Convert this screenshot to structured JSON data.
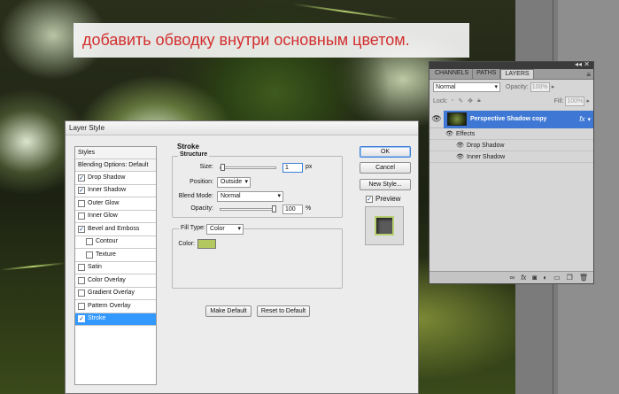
{
  "caption": "добавить обводку внутри основным цветом.",
  "layers_panel": {
    "tabs": [
      "CHANNELS",
      "PATHS",
      "LAYERS"
    ],
    "active_tab": "LAYERS",
    "blend_mode": "Normal",
    "opacity_label": "Opacity:",
    "opacity_value": "100%",
    "lock_label": "Lock:",
    "fill_label": "Fill:",
    "fill_value": "100%",
    "layer_name": "Perspective Shadow copy",
    "fx_label": "fx",
    "effects_label": "Effects",
    "effects": [
      "Drop Shadow",
      "Inner Shadow"
    ],
    "footer_icons": [
      "link-icon",
      "fx-icon",
      "mask-icon",
      "adjustment-icon",
      "folder-icon",
      "new-layer-icon",
      "trash-icon"
    ]
  },
  "dialog": {
    "title": "Layer Style",
    "styles_list": [
      {
        "label": "Styles",
        "type": "header",
        "checked": null,
        "selected": false
      },
      {
        "label": "Blending Options: Default",
        "type": "header",
        "checked": null,
        "selected": false
      },
      {
        "label": "Drop Shadow",
        "type": "item",
        "checked": true,
        "selected": false
      },
      {
        "label": "Inner Shadow",
        "type": "item",
        "checked": true,
        "selected": false
      },
      {
        "label": "Outer Glow",
        "type": "item",
        "checked": false,
        "selected": false
      },
      {
        "label": "Inner Glow",
        "type": "item",
        "checked": false,
        "selected": false
      },
      {
        "label": "Bevel and Emboss",
        "type": "item",
        "checked": true,
        "selected": false
      },
      {
        "label": "Contour",
        "type": "sub",
        "checked": false,
        "selected": false
      },
      {
        "label": "Texture",
        "type": "sub",
        "checked": false,
        "selected": false
      },
      {
        "label": "Satin",
        "type": "item",
        "checked": false,
        "selected": false
      },
      {
        "label": "Color Overlay",
        "type": "item",
        "checked": false,
        "selected": false
      },
      {
        "label": "Gradient Overlay",
        "type": "item",
        "checked": false,
        "selected": false
      },
      {
        "label": "Pattern Overlay",
        "type": "item",
        "checked": false,
        "selected": false
      },
      {
        "label": "Stroke",
        "type": "item",
        "checked": true,
        "selected": true
      }
    ],
    "stroke": {
      "title": "Stroke",
      "structure_title": "Structure",
      "size_label": "Size:",
      "size_value": "1",
      "size_unit": "px",
      "position_label": "Position:",
      "position_value": "Outside",
      "blend_mode_label": "Blend Mode:",
      "blend_mode_value": "Normal",
      "opacity_label": "Opacity:",
      "opacity_value": "100",
      "opacity_unit": "%",
      "opacity_level": 1.0,
      "size_level": 0.01,
      "fill_type_label": "Fill Type:",
      "fill_type_value": "Color",
      "color_label": "Color:",
      "color_value": "#b4c860"
    },
    "buttons": {
      "ok": "OK",
      "cancel": "Cancel",
      "new_style": "New Style...",
      "preview": "Preview",
      "make_default": "Make Default",
      "reset_to_default": "Reset to Default"
    },
    "preview_checked": true
  }
}
